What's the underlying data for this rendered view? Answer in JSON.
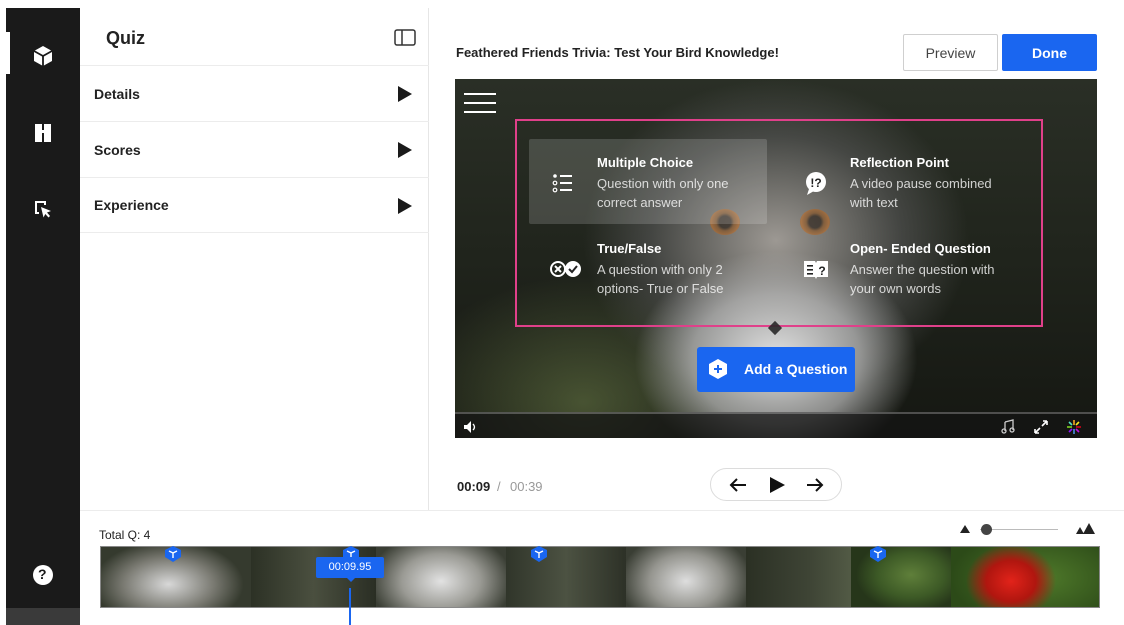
{
  "app": {
    "rail": {
      "items": [
        {
          "icon": "cube-icon"
        },
        {
          "icon": "book-icon"
        },
        {
          "icon": "cursor-select-icon"
        }
      ],
      "help_label": "?"
    },
    "panel": {
      "title": "Quiz",
      "rows": [
        {
          "label": "Details"
        },
        {
          "label": "Scores"
        },
        {
          "label": "Experience"
        }
      ]
    },
    "header": {
      "title": "Feathered Friends Trivia: Test Your Bird Knowledge!",
      "preview_label": "Preview",
      "done_label": "Done"
    },
    "question_types": [
      {
        "title": "Multiple Choice",
        "description": "Question with only one correct answer",
        "icon": "list-icon",
        "active": true
      },
      {
        "title": "Reflection Point",
        "description": "A video pause combined with text",
        "icon": "speech-exclaim-icon",
        "active": false
      },
      {
        "title": "True/False",
        "description": "A question with only 2 options- True or False",
        "icon": "true-false-icon",
        "active": false
      },
      {
        "title": "Open- Ended Question",
        "description": "Answer the question with your own words",
        "icon": "open-question-icon",
        "active": false
      }
    ],
    "add_question_label": "Add a Question",
    "player": {
      "current_time": "00:09",
      "separator": "/",
      "total_time": "00:39"
    },
    "timeline": {
      "total_questions": "Total Q: 4",
      "playhead_time": "00:09.95",
      "marker_count": 4,
      "zoom_level": 0.0
    },
    "colors": {
      "accent": "#1a66f0",
      "highlight_border": "#e0408a",
      "rail_bg": "#1a1a1a"
    }
  }
}
